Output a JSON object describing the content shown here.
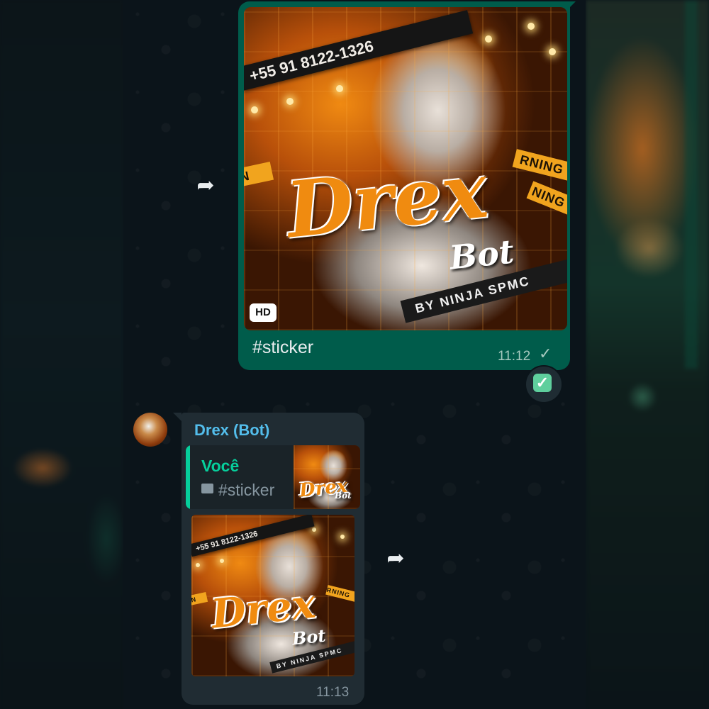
{
  "outgoing": {
    "caption": "#sticker",
    "time": "11:12",
    "status_check": "✓",
    "hd_badge": "HD",
    "reaction": "✓"
  },
  "incoming": {
    "sender": "Drex (Bot)",
    "quote_author": "Você",
    "quote_text": "#sticker",
    "time": "11:13"
  },
  "sticker_art": {
    "phone": "+55 91 8122-1326",
    "brand": "Drex",
    "brand_sub": "Bot",
    "credit": "BY NINJA SPMC",
    "tape_left": "RN",
    "tape_right": "RNING",
    "tape_right2": "NING"
  },
  "icons": {
    "forward": "forward-arrow-icon",
    "image": "image-icon"
  },
  "colors": {
    "outgoing_bubble": "#005c4b",
    "incoming_bubble": "#202c33",
    "sender_name": "#53bdeb",
    "quote_accent": "#06cf9c",
    "background": "#0b141a"
  }
}
